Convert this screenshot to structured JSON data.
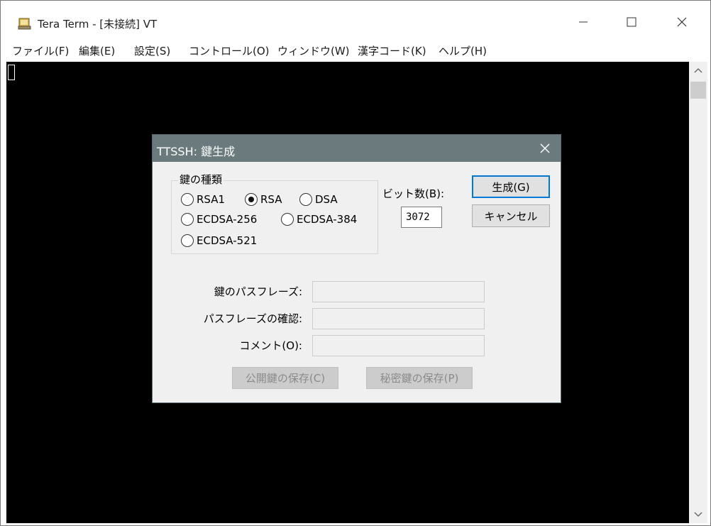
{
  "window": {
    "title": "Tera Term - [未接続] VT"
  },
  "menu": {
    "items": [
      {
        "label": "ファイル(F)"
      },
      {
        "label": "編集(E)"
      },
      {
        "label": "設定(S)"
      },
      {
        "label": "コントロール(O)"
      },
      {
        "label": "ウィンドウ(W)"
      },
      {
        "label": "漢字コード(K)"
      },
      {
        "label": "ヘルプ(H)"
      }
    ]
  },
  "dialog": {
    "title": "TTSSH: 鍵生成",
    "key_type_group": "鍵の種類",
    "key_types": [
      {
        "label": "RSA1",
        "selected": false
      },
      {
        "label": "RSA",
        "selected": true
      },
      {
        "label": "DSA",
        "selected": false
      },
      {
        "label": "ECDSA-256",
        "selected": false
      },
      {
        "label": "ECDSA-384",
        "selected": false
      },
      {
        "label": "ECDSA-521",
        "selected": false
      }
    ],
    "bits_label": "ビット数(B):",
    "bits_value": "3072",
    "generate_button": "生成(G)",
    "cancel_button": "キャンセル",
    "passphrase_label": "鍵のパスフレーズ:",
    "confirm_label": "パスフレーズの確認:",
    "comment_label": "コメント(O):",
    "save_public_button": "公開鍵の保存(C)",
    "save_private_button": "秘密鍵の保存(P)"
  },
  "colors": {
    "terminal_bg": "#000000",
    "dialog_title_bg": "#6b7a7d",
    "default_button_border": "#0078d7"
  },
  "icons": {
    "app": "tera-term-icon",
    "minimize": "minimize-icon",
    "maximize": "maximize-icon",
    "close": "close-icon",
    "dialog_close": "close-icon",
    "scroll_up": "chevron-up-icon",
    "scroll_down": "chevron-down-icon"
  }
}
